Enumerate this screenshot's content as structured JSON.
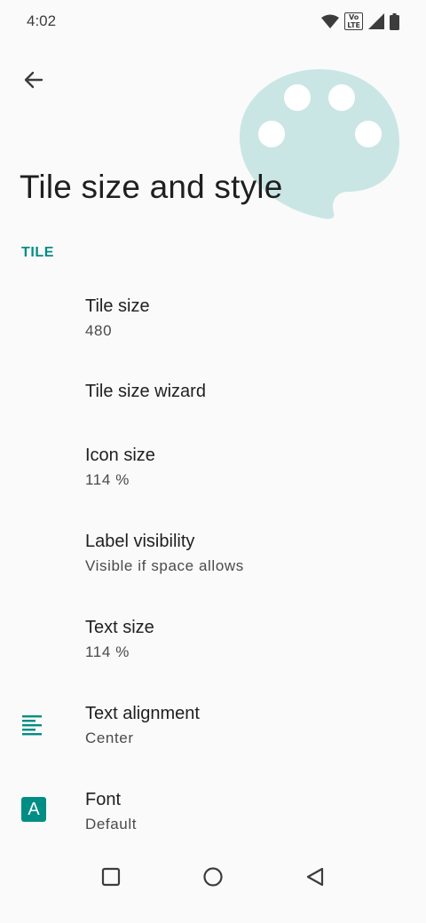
{
  "status_bar": {
    "time": "4:02",
    "icons": [
      "wifi-icon",
      "volte-icon",
      "signal-icon",
      "battery-icon"
    ],
    "volte_text": "Vo LTE"
  },
  "header": {
    "back_icon": "arrow-left-icon",
    "title": "Tile size and style",
    "art_icon": "palette-icon",
    "art_color": "#c9e6e5"
  },
  "section": {
    "label": "TILE",
    "accent_color": "#008d85"
  },
  "items": [
    {
      "title": "Tile size",
      "summary": "480"
    },
    {
      "title": "Tile size wizard",
      "summary": ""
    },
    {
      "title": "Icon size",
      "summary": "114 %"
    },
    {
      "title": "Label visibility",
      "summary": "Visible if space allows"
    },
    {
      "title": "Text size",
      "summary": "114 %"
    },
    {
      "title": "Text alignment",
      "summary": "Center",
      "icon": "align-center-icon"
    },
    {
      "title": "Font",
      "summary": "Default",
      "icon": "font-icon",
      "icon_letter": "A"
    }
  ],
  "nav_bar": {
    "buttons": [
      "recents-square-icon",
      "home-circle-icon",
      "back-triangle-icon"
    ]
  }
}
